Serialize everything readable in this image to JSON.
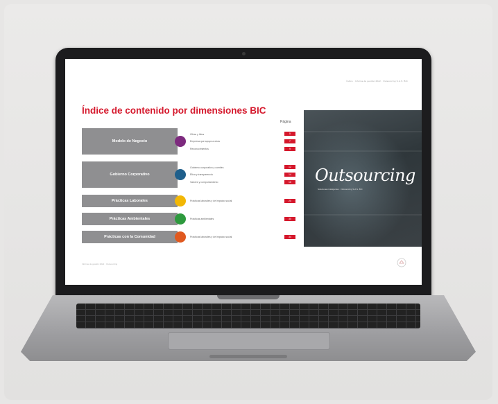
{
  "slide": {
    "header": "Índice · Informe de gestión 2022 · Outsourcing S.A.S. BIC",
    "title": "Índice de contenido por dimensiones BIC",
    "pages_label": "Página",
    "rows": [
      {
        "dimension": "Modelo de Negocio",
        "color": "#7d2a7e",
        "items": [
          "Cifras y hitos",
          "Empresa que apoya a otras",
          "Reconocimientos"
        ],
        "pages": [
          "5",
          "7",
          "9"
        ]
      },
      {
        "dimension": "Gobierno Corporativo",
        "color": "#1f5f8b",
        "items": [
          "Gobierno corporativo y comités",
          "Ética y transparencia",
          "Valores y comportamiento"
        ],
        "pages": [
          "12",
          "14",
          "16"
        ]
      },
      {
        "dimension": "Prácticas Laborales",
        "color": "#f2b705",
        "items": [
          "Prácticas laborales y de impacto social"
        ],
        "pages": [
          "20"
        ]
      },
      {
        "dimension": "Prácticas Ambientales",
        "color": "#2e9a3e",
        "items": [
          "Prácticas ambientales"
        ],
        "pages": [
          "30"
        ]
      },
      {
        "dimension": "Prácticas con la Comunidad",
        "color": "#e0591f",
        "items": [
          "Prácticas laborales y de impacto social"
        ],
        "pages": [
          "34"
        ]
      }
    ],
    "brand": "Outsourcing",
    "brand_tagline": "Soluciones inteligentes · Outsourcing S.A.S. BIC",
    "footer": "Informe de gestión 2022 · Outsourcing"
  },
  "colors": {
    "accent": "#d5182c",
    "dimension_bg": "#8f8f91"
  }
}
